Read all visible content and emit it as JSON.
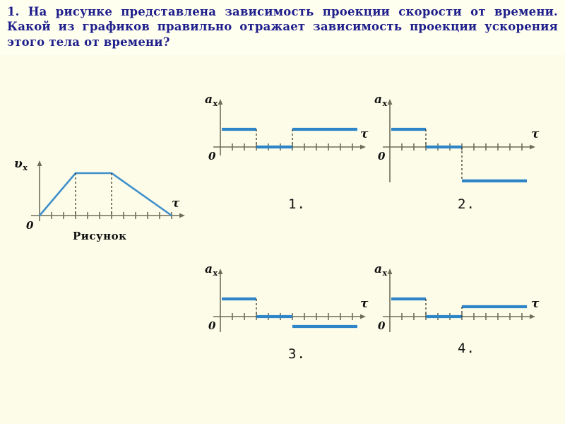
{
  "page": {
    "background_color": "#FCFCE8",
    "accent_color": "#2E86C8",
    "axis_color": "#6E6E58",
    "heading_color": "#1F1F8C"
  },
  "question": {
    "number": "1.",
    "text": "1. На рисунке представлена зависимость проекции скорости от времени. Какой из графиков правильно отражает зависимость проекции ускорения этого тела от времени?"
  },
  "figure": {
    "caption": "Рисунок",
    "y_axis_label": "υ",
    "y_axis_subscript": "x",
    "x_axis_label": "τ",
    "origin_label": "0"
  },
  "options_axis": {
    "y_axis_label": "a",
    "y_axis_subscript": "x",
    "x_axis_label": "τ",
    "origin_label": "0"
  },
  "options": [
    {
      "number": "1.",
      "description": "positive, zero, positive"
    },
    {
      "number": "2.",
      "description": "positive, zero, negative"
    },
    {
      "number": "3.",
      "description": "positive, zero, small negative"
    },
    {
      "number": "4.",
      "description": "positive, zero, small positive"
    }
  ],
  "chart_data": [
    {
      "type": "line",
      "title": "Рисунок",
      "xlabel": "τ",
      "ylabel": "υx",
      "xlim": [
        0,
        11
      ],
      "ylim": [
        0,
        4
      ],
      "grid": false,
      "x": [
        0,
        3,
        6,
        11
      ],
      "values": [
        0,
        3,
        3,
        0
      ],
      "tick_count": 11,
      "dashed_guides": [
        3,
        6
      ]
    },
    {
      "type": "line",
      "title": "1.",
      "xlabel": "τ",
      "ylabel": "ax",
      "xlim": [
        0,
        11
      ],
      "ylim": [
        -2,
        3
      ],
      "grid": false,
      "segments": [
        {
          "x_start": 0,
          "x_end": 3,
          "y": 1.0
        },
        {
          "x_start": 3,
          "x_end": 6,
          "y": 0
        },
        {
          "x_start": 6,
          "x_end": 11,
          "y": 1.0
        }
      ],
      "tick_count": 11,
      "dashed_guides": [
        3,
        6
      ]
    },
    {
      "type": "line",
      "title": "2.",
      "xlabel": "τ",
      "ylabel": "ax",
      "xlim": [
        0,
        11
      ],
      "ylim": [
        -2,
        3
      ],
      "grid": false,
      "segments": [
        {
          "x_start": 0,
          "x_end": 3,
          "y": 1.0
        },
        {
          "x_start": 3,
          "x_end": 6,
          "y": 0
        },
        {
          "x_start": 6,
          "x_end": 11,
          "y": -1.4
        }
      ],
      "tick_count": 11,
      "dashed_guides": [
        3,
        6
      ]
    },
    {
      "type": "line",
      "title": "3.",
      "xlabel": "τ",
      "ylabel": "ax",
      "xlim": [
        0,
        11
      ],
      "ylim": [
        -2,
        3
      ],
      "grid": false,
      "segments": [
        {
          "x_start": 0,
          "x_end": 3,
          "y": 1.0
        },
        {
          "x_start": 3,
          "x_end": 6,
          "y": 0
        },
        {
          "x_start": 6,
          "x_end": 11,
          "y": -0.42
        }
      ],
      "tick_count": 11,
      "dashed_guides": [
        3
      ]
    },
    {
      "type": "line",
      "title": "4.",
      "xlabel": "τ",
      "ylabel": "ax",
      "xlim": [
        0,
        11
      ],
      "ylim": [
        -2,
        3
      ],
      "grid": false,
      "segments": [
        {
          "x_start": 0,
          "x_end": 3,
          "y": 1.0
        },
        {
          "x_start": 3,
          "x_end": 6,
          "y": 0
        },
        {
          "x_start": 6,
          "x_end": 11,
          "y": 0.42
        }
      ],
      "tick_count": 11,
      "dashed_guides": [
        3
      ]
    }
  ]
}
